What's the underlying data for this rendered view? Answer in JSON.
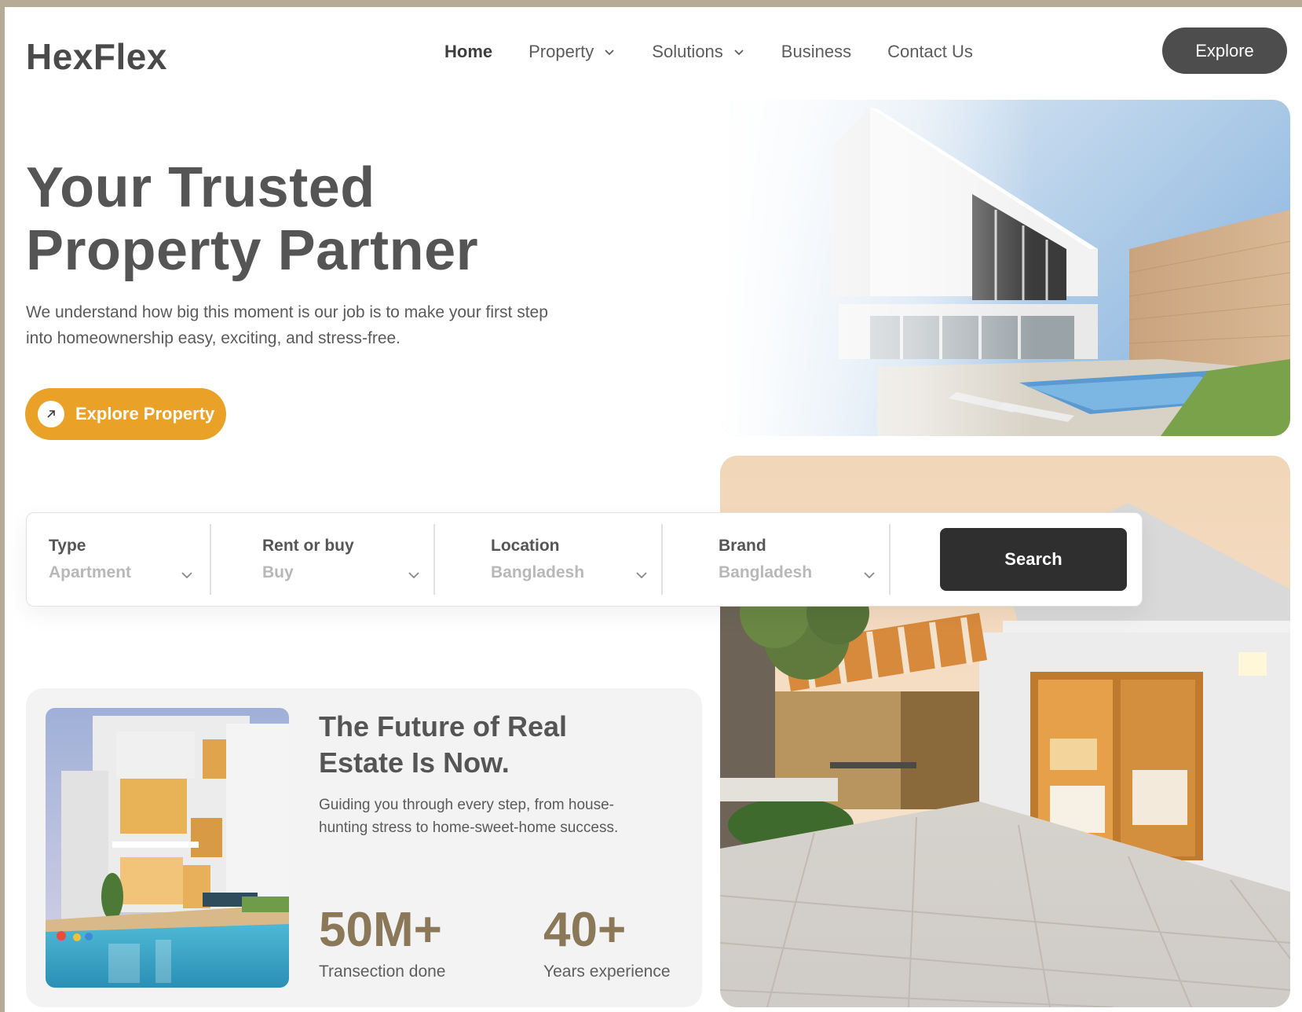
{
  "header": {
    "logo": "HexFlex",
    "nav": [
      {
        "label": "Home",
        "active": true,
        "dropdown": false
      },
      {
        "label": "Property",
        "active": false,
        "dropdown": true
      },
      {
        "label": "Solutions",
        "active": false,
        "dropdown": true
      },
      {
        "label": "Business",
        "active": false,
        "dropdown": false
      },
      {
        "label": "Contact Us",
        "active": false,
        "dropdown": false
      }
    ],
    "cta_label": "Explore"
  },
  "hero": {
    "title_line1": "Your Trusted",
    "title_line2": "Property Partner",
    "description": "We understand how big this moment is our job is to make your first step into homeownership easy, exciting, and stress-free.",
    "cta_label": "Explore Property"
  },
  "search": {
    "fields": [
      {
        "label": "Type",
        "value": "Apartment"
      },
      {
        "label": "Rent or buy",
        "value": "Buy"
      },
      {
        "label": "Location",
        "value": "Bangladesh"
      },
      {
        "label": "Brand",
        "value": "Bangladesh"
      }
    ],
    "button_label": "Search"
  },
  "feature_card": {
    "title_line1": "The Future of Real",
    "title_line2": "Estate Is Now.",
    "description": "Guiding you through every step, from house-hunting stress to home-sweet-home success.",
    "stats": [
      {
        "value": "50M+",
        "label": "Transection done"
      },
      {
        "value": "40+",
        "label": "Years experience"
      }
    ]
  },
  "colors": {
    "accent": "#e9a227",
    "dark": "#2f2f2f",
    "stat": "#8a7858",
    "frame": "#b5ab97"
  }
}
